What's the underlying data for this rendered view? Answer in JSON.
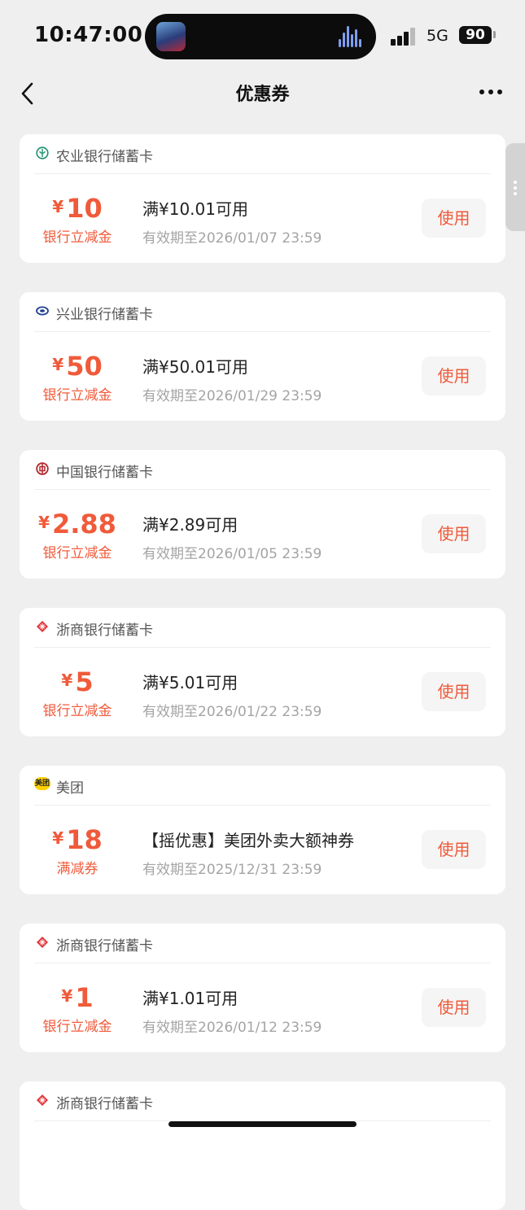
{
  "status_bar": {
    "time": "10:47:00",
    "network": "5G",
    "battery": "90"
  },
  "nav": {
    "title": "优惠券"
  },
  "coupons": [
    {
      "bank": "农业银行储蓄卡",
      "icon": "abc-bank-icon",
      "amount": "10",
      "tag": "银行立减金",
      "condition": "满¥10.01可用",
      "expiry": "有效期至2026/01/07 23:59",
      "button": "使用"
    },
    {
      "bank": "兴业银行储蓄卡",
      "icon": "cib-bank-icon",
      "amount": "50",
      "tag": "银行立减金",
      "condition": "满¥50.01可用",
      "expiry": "有效期至2026/01/29 23:59",
      "button": "使用"
    },
    {
      "bank": "中国银行储蓄卡",
      "icon": "boc-bank-icon",
      "amount": "2.88",
      "tag": "银行立减金",
      "condition": "满¥2.89可用",
      "expiry": "有效期至2026/01/05 23:59",
      "button": "使用"
    },
    {
      "bank": "浙商银行储蓄卡",
      "icon": "czb-bank-icon",
      "amount": "5",
      "tag": "银行立减金",
      "condition": "满¥5.01可用",
      "expiry": "有效期至2026/01/22 23:59",
      "button": "使用"
    },
    {
      "bank": "美团",
      "icon": "meituan-icon",
      "icon_text": "美团",
      "amount": "18",
      "tag": "满减券",
      "condition": "【摇优惠】美团外卖大额神券",
      "expiry": "有效期至2025/12/31 23:59",
      "button": "使用"
    },
    {
      "bank": "浙商银行储蓄卡",
      "icon": "czb-bank-icon",
      "amount": "1",
      "tag": "银行立减金",
      "condition": "满¥1.01可用",
      "expiry": "有效期至2026/01/12 23:59",
      "button": "使用"
    },
    {
      "bank": "浙商银行储蓄卡",
      "icon": "czb-bank-icon"
    }
  ],
  "currency_symbol": "¥",
  "colors": {
    "accent": "#f05a3a",
    "background": "#efefef"
  }
}
